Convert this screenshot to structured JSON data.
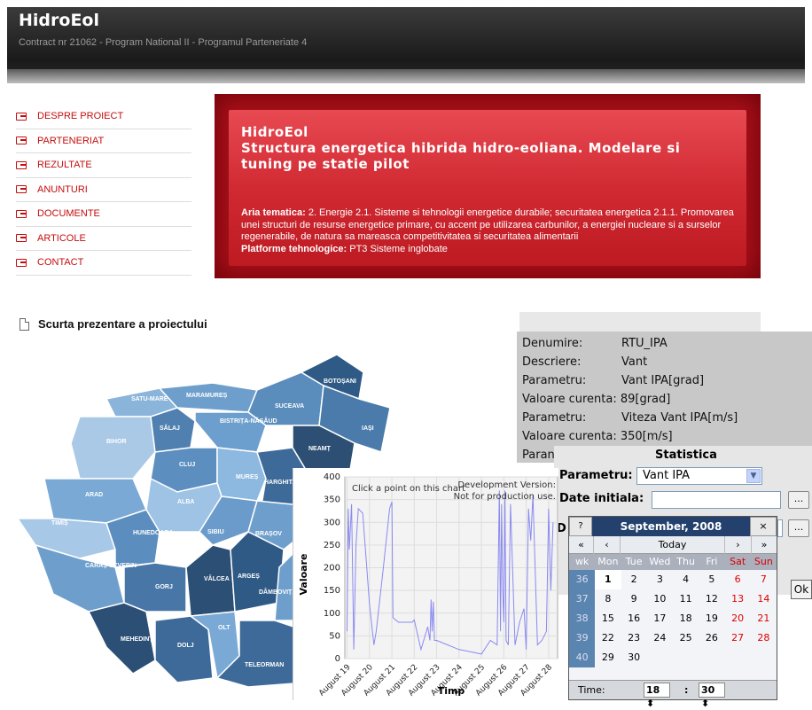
{
  "header": {
    "title": "HidroEol",
    "subtitle": "Contract nr 21062 - Program National II - Programul Parteneriate 4"
  },
  "menu": {
    "items": [
      "DESPRE PROIECT",
      "PARTENERIAT",
      "REZULTATE",
      "ANUNTURI",
      "DOCUMENTE",
      "ARTICOLE",
      "CONTACT"
    ]
  },
  "hero": {
    "title": "HidroEol",
    "subtitle": "Structura energetica hibrida hidro-eoliana. Modelare si tuning pe statie pilot",
    "aria_label": "Aria tematica:",
    "aria_text": " 2. Energie 2.1. Sisteme si tehnologii energetice durabile; securitatea energetica 2.1.1. Promovarea unei structuri de resurse energetice primare, cu accent pe utilizarea carbunilor, a energiei nucleare si a surselor regenerabile, de natura sa mareasca competitivitatea si securitatea alimentarii",
    "platforme_label": "Platforme tehnologice:",
    "platforme_text": " PT3 Sisteme inglobate"
  },
  "section": {
    "title": "Scurta prezentare a proiectului"
  },
  "map": {
    "counties": [
      "SATU-MARE",
      "MARAMUREȘ",
      "BOTOȘANI",
      "SUCEAVA",
      "SĂLAJ",
      "BISTRIȚA-NĂSĂUD",
      "BIHOR",
      "IAȘI",
      "NEAMȚ",
      "CLUJ",
      "MUREȘ",
      "HARGHITA",
      "ARAD",
      "ALBA",
      "TIMIȘ",
      "HUNEDOARA",
      "SIBIU",
      "BRAȘOV",
      "CARAȘ-SEVERIN",
      "GORJ",
      "VÂLCEA",
      "ARGEȘ",
      "DÂMBOVIȚA",
      "MEHEDINȚI",
      "OLT",
      "DOLJ",
      "TELEORMAN"
    ]
  },
  "info": {
    "rows": [
      {
        "k": "Denumire:",
        "v": "RTU_IPA"
      },
      {
        "k": "Descriere:",
        "v": "Vant"
      },
      {
        "k": "Parametru:",
        "v": "Vant IPA[grad]"
      },
      {
        "k": "Valoare curenta:",
        "v": "89[grad]",
        "inline": true
      },
      {
        "k": "Parametru:",
        "v": "Viteza Vant IPA[m/s]"
      },
      {
        "k": "Valoare curenta:",
        "v": "350[m/s]",
        "inline": true
      },
      {
        "k": "Paran",
        "v": ""
      }
    ]
  },
  "stat": {
    "title": "Statistica",
    "param_label": "Parametru:",
    "param_value": "Vant IPA",
    "date_label": "Date initiala:",
    "d_label": "D",
    "dots": "...",
    "ok": "Ok"
  },
  "calendar": {
    "help": "?",
    "month": "September, 2008",
    "close": "×",
    "nav": [
      "«",
      "‹",
      "Today",
      "›",
      "»"
    ],
    "days": [
      "wk",
      "Mon",
      "Tue",
      "Wed",
      "Thu",
      "Fri",
      "Sat",
      "Sun"
    ],
    "weeks": [
      [
        "36",
        "1",
        "2",
        "3",
        "4",
        "5",
        "6",
        "7"
      ],
      [
        "37",
        "8",
        "9",
        "10",
        "11",
        "12",
        "13",
        "14"
      ],
      [
        "38",
        "15",
        "16",
        "17",
        "18",
        "19",
        "20",
        "21"
      ],
      [
        "39",
        "22",
        "23",
        "24",
        "25",
        "26",
        "27",
        "28"
      ],
      [
        "40",
        "29",
        "30",
        "",
        "",
        "",
        "",
        ""
      ]
    ],
    "time_label": "Time:",
    "hour": "18",
    "minute": "30",
    "sep": ":"
  },
  "chart_data": {
    "type": "line",
    "ylabel": "Valoare",
    "xlabel": "Timp",
    "ylim": [
      0,
      400
    ],
    "yticks": [
      "0",
      "50",
      "100",
      "150",
      "200",
      "250",
      "300",
      "350",
      "400"
    ],
    "xticks": [
      "August 19",
      "August 20",
      "August 21",
      "August 22",
      "August 23",
      "August 24",
      "August 25",
      "August 26",
      "August 27",
      "August 28"
    ],
    "note": "Click a point on this chart",
    "watermark1": "Development Version:",
    "watermark2": "Not for production use.",
    "x": [
      19.0,
      19.05,
      19.1,
      19.2,
      19.3,
      19.4,
      19.5,
      19.7,
      20.0,
      20.2,
      20.3,
      20.6,
      20.9,
      21.0,
      21.05,
      21.3,
      21.6,
      21.9,
      22.0,
      22.3,
      22.6,
      22.7,
      22.75,
      22.8,
      22.85,
      22.9,
      23.0,
      23.5,
      24.0,
      24.5,
      25.0,
      25.4,
      25.7,
      25.8,
      25.85,
      25.9,
      25.95,
      26.0,
      26.05,
      26.1,
      26.2,
      26.3,
      26.5,
      26.7,
      26.9,
      27.0,
      27.1,
      27.2,
      27.3,
      27.5,
      27.7,
      27.9,
      28.0,
      28.1,
      28.2
    ],
    "values": [
      60,
      330,
      240,
      340,
      20,
      250,
      330,
      320,
      120,
      30,
      60,
      190,
      330,
      345,
      90,
      80,
      80,
      80,
      85,
      20,
      70,
      40,
      130,
      60,
      125,
      40,
      40,
      30,
      20,
      15,
      10,
      40,
      30,
      370,
      60,
      340,
      150,
      80,
      370,
      40,
      30,
      340,
      30,
      80,
      110,
      20,
      330,
      260,
      360,
      30,
      40,
      60,
      330,
      150,
      300
    ]
  }
}
